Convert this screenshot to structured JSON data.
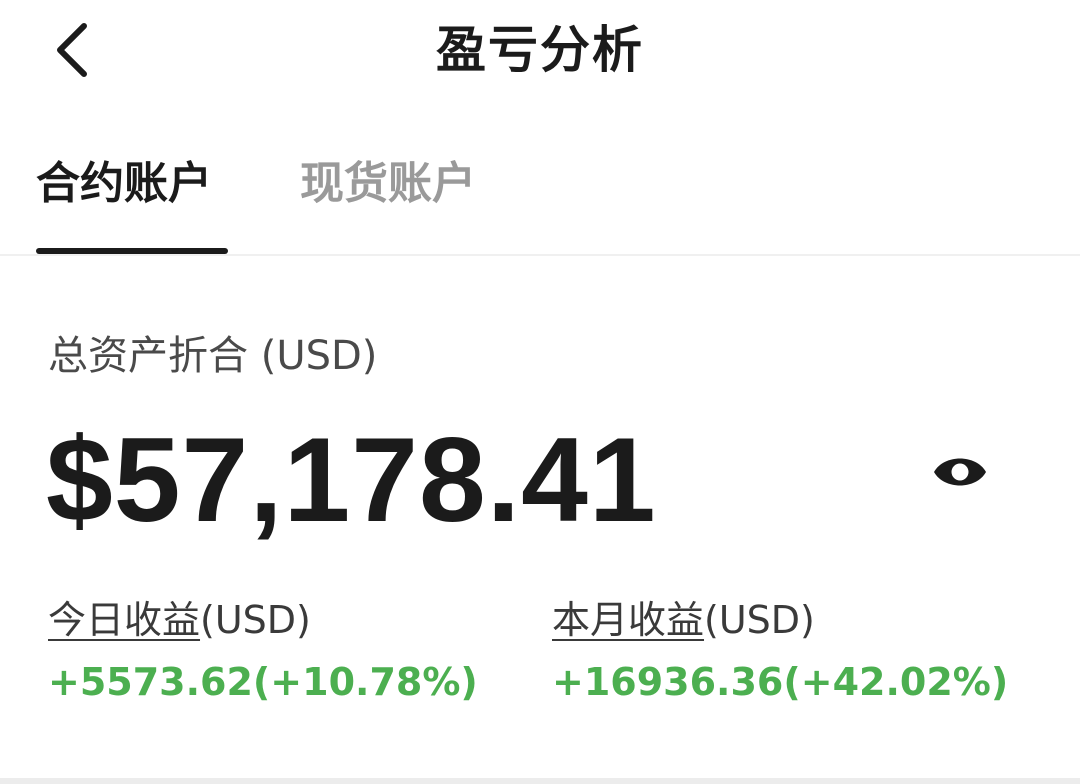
{
  "header": {
    "title": "盈亏分析",
    "back_icon": "chevron-left-icon"
  },
  "tabs": [
    {
      "label": "合约账户",
      "active": true
    },
    {
      "label": "现货账户",
      "active": false
    }
  ],
  "assets": {
    "label": "总资产折合 (USD)",
    "value": "$57,178.41",
    "visibility_icon": "eye-icon"
  },
  "pnl": {
    "today": {
      "label": "今日收益",
      "unit": "(USD)",
      "value": "+5573.62(+10.78%)"
    },
    "month": {
      "label": "本月收益",
      "unit": "(USD)",
      "value": "+16936.36(+42.02%)"
    }
  },
  "colors": {
    "positive": "#4caf50",
    "primary_text": "#1b1b1b",
    "inactive_tab": "#9a9a9a"
  }
}
